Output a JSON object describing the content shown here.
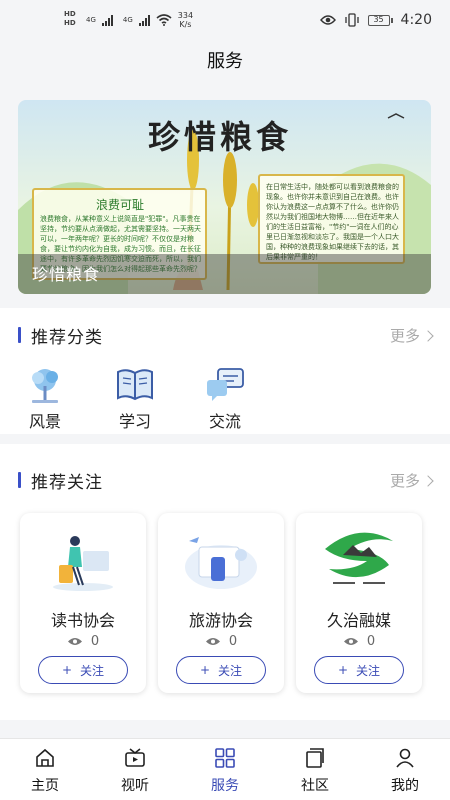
{
  "status_bar": {
    "hd_top": "HD",
    "hd_bottom": "HD",
    "network_1": "4G",
    "network_2": "4G",
    "speed_value": "334",
    "speed_unit": "K/s",
    "battery": "35",
    "time": "4:20"
  },
  "header": {
    "title": "服务"
  },
  "banner": {
    "big_title": "珍惜粮食",
    "caption": "珍惜粮食",
    "left_panel_title": "浪费可耻",
    "left_panel_text": "浪费粮食，从某种意义上说简直是\"犯罪\"。凡事贵在坚持，节约要从点滴做起，尤其需要坚持。一天两天可以，一年两年呢？更长的时间呢？不仅仅是对粮食，要让节约内化为自我，成为习惯。而且，在长征途中，有许多革命先烈因饥寒交迫而死，所以，我们要节约粮食，因为我们怎么对得起那些革命先烈呢？",
    "right_panel_text": "在日常生活中，随处都可以看到浪费粮食的现象。也许你并未意识到自己在浪费。也许你认为浪费这一点点算不了什么。也许你仍然以为我们祖国地大物博……但在近年来人们的生活日益富裕，\"节约\"一词在人们的心里已日渐忽视和淡忘了。我国是一个人口大国，种种的浪费现象如果继续下去的话，其后果非常严重的！"
  },
  "categories": {
    "title": "推荐分类",
    "more": "更多",
    "items": [
      {
        "label": "风景",
        "icon": "landscape-icon"
      },
      {
        "label": "学习",
        "icon": "book-icon"
      },
      {
        "label": "交流",
        "icon": "chat-icon"
      }
    ]
  },
  "follows": {
    "title": "推荐关注",
    "more": "更多",
    "items": [
      {
        "name": "读书协会",
        "views": "0",
        "button": "关注",
        "button_prefix": "+"
      },
      {
        "name": "旅游协会",
        "views": "0",
        "button": "关注",
        "button_prefix": "+"
      },
      {
        "name": "久治融媒",
        "views": "0",
        "button": "关注",
        "button_prefix": "+"
      }
    ]
  },
  "bottom_nav": {
    "active": 2,
    "accent": "#3a4bb5",
    "items": [
      {
        "label": "主页",
        "icon": "home-icon"
      },
      {
        "label": "视听",
        "icon": "video-icon"
      },
      {
        "label": "服务",
        "icon": "grid-icon"
      },
      {
        "label": "社区",
        "icon": "community-icon"
      },
      {
        "label": "我的",
        "icon": "profile-icon"
      }
    ]
  },
  "colors": {
    "accent": "#3a4bb5",
    "section_bar": "#3a50c8",
    "background": "#f4f5f7"
  }
}
